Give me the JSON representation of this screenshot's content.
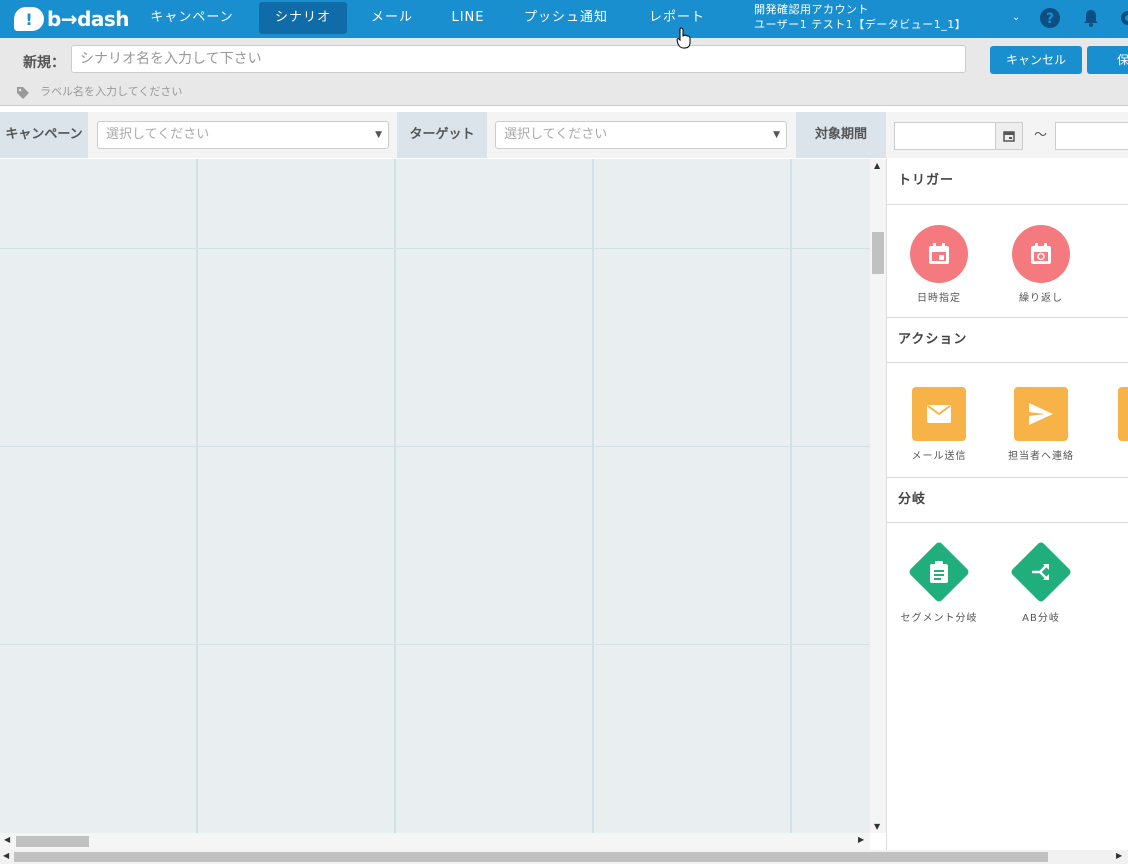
{
  "brand": {
    "logo_mark": "!",
    "logo_text": "b→dash"
  },
  "nav": {
    "items": [
      {
        "label": "キャンペーン",
        "active": false
      },
      {
        "label": "シナリオ",
        "active": true
      },
      {
        "label": "メール",
        "active": false
      },
      {
        "label": "LINE",
        "active": false
      },
      {
        "label": "プッシュ通知",
        "active": false
      },
      {
        "label": "レポート",
        "active": false
      }
    ]
  },
  "account": {
    "line1": "開発確認用アカウント",
    "line2": "ユーザー1 テスト1【データビュー1_1】",
    "caret": "⌄"
  },
  "top_icons": [
    "help-icon",
    "bell-icon",
    "gear-icon"
  ],
  "scenario": {
    "prefix": "新規：",
    "name_placeholder": "シナリオ名を入力して下さい",
    "label_placeholder": "ラベル名を入力してください",
    "cancel_label": "キャンセル",
    "save_label": "保"
  },
  "filters": {
    "campaign_label": "キャンペーン",
    "campaign_placeholder": "選択してください",
    "target_label": "ターゲット",
    "target_placeholder": "選択してください",
    "period_label": "対象期間",
    "tilde": "～"
  },
  "palette": {
    "trigger": {
      "title": "トリガー",
      "items": [
        {
          "label": "日時指定",
          "icon": "calendar-icon"
        },
        {
          "label": "繰り返し",
          "icon": "calendar-repeat-icon"
        }
      ]
    },
    "action": {
      "title": "アクション",
      "items": [
        {
          "label": "メール送信",
          "icon": "mail-icon"
        },
        {
          "label": "担当者へ連絡",
          "icon": "send-icon"
        }
      ]
    },
    "branch": {
      "title": "分岐",
      "items": [
        {
          "label": "セグメント分岐",
          "icon": "clipboard-icon"
        },
        {
          "label": "AB分岐",
          "icon": "split-icon"
        }
      ]
    }
  },
  "colors": {
    "nav_bg": "#1a8fd0",
    "trigger": "#f47a7f",
    "action": "#f7b347",
    "branch": "#1fae7c"
  }
}
